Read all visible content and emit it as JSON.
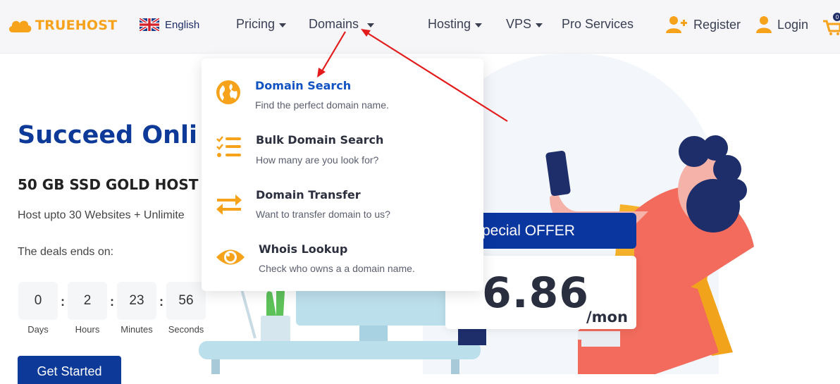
{
  "nav": {
    "logo_text": "TRUEHOST",
    "language": "English",
    "menu": [
      {
        "label": "Pricing"
      },
      {
        "label": "Domains"
      },
      {
        "label": "Hosting"
      },
      {
        "label": "VPS"
      },
      {
        "label": "Pro Services"
      }
    ],
    "register": "Register",
    "login": "Login",
    "cart_count": "0"
  },
  "hero": {
    "title": "Succeed Onli",
    "subtitle": "50 GB SSD GOLD HOST",
    "description": "Host upto 30 Websites + Unlimite",
    "deals_label": "The deals ends on:",
    "countdown": [
      {
        "value": "0",
        "label": "Days"
      },
      {
        "value": "2",
        "label": "Hours"
      },
      {
        "value": "23",
        "label": "Minutes"
      },
      {
        "value": "56",
        "label": "Seconds"
      }
    ],
    "cta": "Get Started"
  },
  "dropdown": {
    "items": [
      {
        "title": "Domain Search",
        "desc": "Find the perfect domain name.",
        "icon": "globe-icon"
      },
      {
        "title": "Bulk Domain Search",
        "desc": "How many are you look for?",
        "icon": "list-icon"
      },
      {
        "title": "Domain Transfer",
        "desc": "Want to transfer domain to us?",
        "icon": "transfer-arrows-icon"
      },
      {
        "title": "Whois Lookup",
        "desc": "Check who owns a a domain name.",
        "icon": "eye-icon"
      }
    ]
  },
  "offer": {
    "banner": "pecial OFFER",
    "price": "6.86",
    "unit": "/mon"
  },
  "colors": {
    "brand_orange": "#f7a21b",
    "brand_blue": "#0d3a98",
    "active_link": "#1152c2",
    "annotation_red": "#e31b1b"
  }
}
